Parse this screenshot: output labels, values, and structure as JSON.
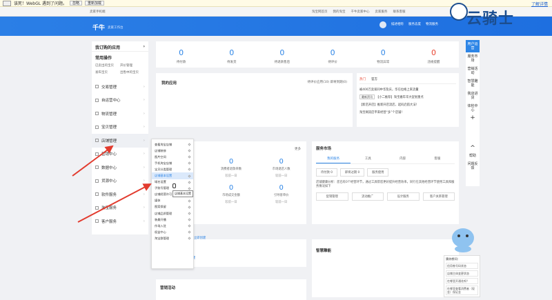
{
  "warning_bar": {
    "message": "该死！WebGL 遇到了问题。",
    "ignore_button": "忽略",
    "reload_button": "重新加载",
    "help_link": "了解详情"
  },
  "top_nav": {
    "user": "卖家手机端",
    "links": [
      "淘宝网首页",
      "我的淘宝",
      "千牛卖家中心",
      "卖家服务",
      "联系客服"
    ]
  },
  "header": {
    "brand": "千牛",
    "subtitle": "卖家工作台",
    "items": [
      "描述相符",
      "服务态度",
      "物流服务"
    ],
    "watermark": "云骑士"
  },
  "sidebar": {
    "title": "我订购的应用",
    "common_title": "常用操作",
    "quick_links": [
      "已卖出的宝贝",
      "开价管理",
      "发布宝贝",
      "出售中的宝贝"
    ],
    "items": [
      "交易管理",
      "自运营中心",
      "物流管理",
      "宝贝管理",
      "店铺管理",
      "营销中心",
      "数据中心",
      "货源中心",
      "软件服务",
      "淘宝服务",
      "客户服务"
    ]
  },
  "stats": [
    {
      "value": "0",
      "label": "待付款"
    },
    {
      "value": "0",
      "label": "待发货"
    },
    {
      "value": "0",
      "label": "待退款售后"
    },
    {
      "value": "0",
      "label": "待评价"
    },
    {
      "value": "0",
      "label": "物流异常"
    },
    {
      "value": "0",
      "label": "违规提醒"
    }
  ],
  "apps": {
    "title": "我的应用",
    "options": "待评价应用(10)  即将到期(0)"
  },
  "news": {
    "tabs": [
      "热门",
      "官方"
    ],
    "lines": [
      "被400万卖家同中华及庆，华在拉格上来流量",
      "【小二推荐】淘宝嘉年华大促划重点",
      "【新店开店】推新开店流店，起码启航大法！",
      "淘宝网双店平来经营“多”个店铺！"
    ],
    "tag": "最新资讯"
  },
  "shop_status": {
    "more": "更多",
    "row1": [
      {
        "value": "0",
        "label": "消费者退款率数",
        "compare": "较前一日"
      },
      {
        "value": "0",
        "label": "市场退店人数",
        "compare": "较前一日"
      }
    ],
    "row2": [
      {
        "value": "0",
        "label": "市场成交金额",
        "compare": "较前一日"
      },
      {
        "value": "0",
        "label": "引导客单价",
        "compare": "较前一日"
      }
    ],
    "create_link": "立即创建"
  },
  "service_market": {
    "title": "服务市场",
    "tabs": [
      "我的服务",
      "工具",
      "内容",
      "客服"
    ],
    "buttons": [
      "待付款 0",
      "即将过期 0",
      "服务使用"
    ],
    "text": "店铺健康分析：您已有0个经营环节，通过工具帮您更好提升经营效率。同行在其他经营环节使用工具和服务情况如下",
    "grid": [
      "促销管理",
      "流动推广",
      "设计服务",
      "客户关系管理"
    ]
  },
  "smart": {
    "title": "智慧雕能"
  },
  "marketing": {
    "title": "营销活动"
  },
  "right_side": {
    "items": [
      "用户运营",
      "服务市场",
      "营销活动",
      "智慧雕能",
      "我店进货",
      "体检中心"
    ],
    "items2": [
      "帮助",
      "问题反馈"
    ]
  },
  "submenu": {
    "items": [
      "查看淘宝店铺",
      "店铺装修",
      "图片空间",
      "手机淘宝店铺",
      "宝贝分类管理",
      "店铺基本设置",
      "域名设置",
      "子账号管理",
      "店铺经营许可",
      "媒体",
      "图案保留",
      "店铺品质管理",
      "装最开播",
      "作场入驻",
      "权益中心",
      "淘宝群管理"
    ],
    "highlighted_index": 5,
    "tooltip": "店铺基本设置"
  },
  "helper": {
    "title": "猜你想问：",
    "items": [
      "信用卷号码状态",
      "店铺主体变更状态",
      "在哪里开通花呗？",
      "在哪里查看消费者（现金）保证金"
    ]
  },
  "colors": {
    "header_blue": "#2b7fe6",
    "accent_blue": "#2d85e6",
    "alert_red": "#e8432f",
    "arrow_red": "#e23b2e"
  }
}
